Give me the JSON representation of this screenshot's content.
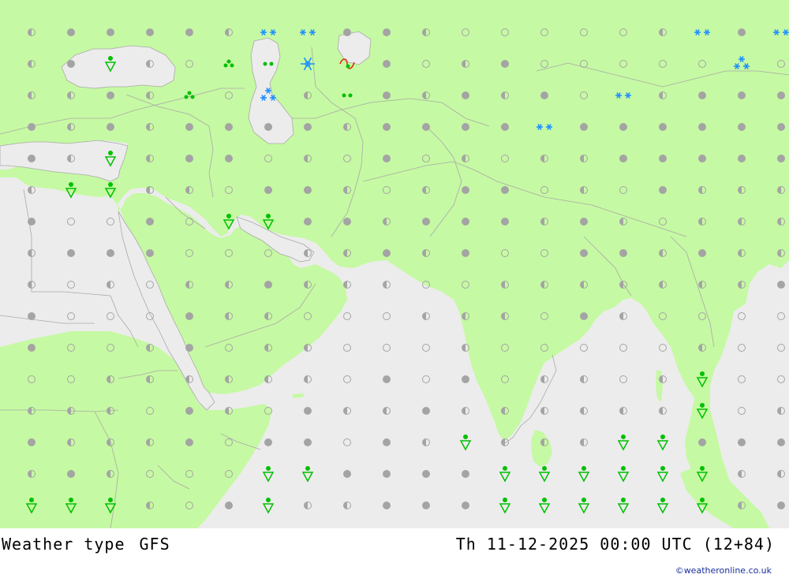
{
  "title": "Weather type",
  "model": "GFS",
  "valid_time": "Th 11-12-2025 00:00 UTC (12+84)",
  "credit": "©weatheronline.co.uk",
  "colors": {
    "land": "#c6f9a3",
    "sea": "#ececec",
    "border": "#a9a9a9",
    "dot": "#a4a4a4",
    "rain": "#00c000",
    "snow": "#1e90ff",
    "freezing": "#e03010"
  },
  "icon_legend": {
    "filled-dot": "overcast",
    "half-dot": "partly cloudy",
    "open-dot": "clear",
    "snow-pair": "snow",
    "snowflake": "heavy snow",
    "rain-dots": "rain",
    "rain-shower": "rain shower",
    "freezing-rain": "freezing rain"
  },
  "grid": {
    "rows": [
      "hFFFhoFhFFsFhFFhooooosFsFF",
      "hrhhhhhhhhhhhhhhhhhhhhhhhhhhhhhhhhhhhhhhhhhh",
      "hhhhhhhhhhhhhhhhhhhhhhhhhhhhhhhhhhhhhhhhhhhh",
      "FFhhhhhhhhhhhhhhhhhhhhhhhhhhhhhhhhhhhhhhhhhh"
    ],
    "cells": [
      "hFFFFhsshoFhFooooohsFsFF",
      "FhRhoRPoFoFhFhFoooSoSoSF",
      "FhFhoFPhPFSFhFoooosoFFhFo",
      "FhFhFFFFhFFFFFSFFFFhFFFFh",
      "FFhRhFFhhFhhhhhoFhooohhoo",
      "hRRhhoFFhohFFhhhhhhhohhoo",
      "FhooFoFRRFFhFFFFFhhhFhFFh",
      "hFFFooohhFhFooFFhFhhhFhhh",
      "hohohhFhhhhoohhhhhhhhohhh",
      "FoooohhooohhhoFhhohooohhF",
      "hoohhohhooohoooooooooohoF",
      "oohhhhhhhhoFohhohohoooFhh",
      "hhhoFhoFhhFhhhhhhhhhhhRhh",
      "hhhhhhhhhhhhhhhhhhhhhhhhh"
    ],
    "layout": {
      "weather": [
        [
          "half",
          "filled",
          "filled",
          "filled",
          "filled",
          "half",
          "snow2",
          "snow2",
          "filled",
          "filled",
          "half",
          "open",
          "open",
          "open",
          "open",
          "open",
          "half",
          "snow2",
          "filled",
          "snow2",
          "filled",
          "filled"
        ],
        [
          "half",
          "filled",
          "shower",
          "half",
          "open",
          "rain3",
          "rain2",
          "snowflake",
          "freezing",
          "filled",
          "open",
          "half",
          "filled",
          "open",
          "open",
          "open",
          "open",
          "open",
          "snow3",
          "open",
          "snow3",
          "filled"
        ],
        [
          "half",
          "half",
          "filled",
          "half",
          "rain3",
          "open",
          "snow3",
          "half",
          "rain2",
          "filled",
          "half",
          "filled",
          "half",
          "filled",
          "open",
          "snow2",
          "half",
          "filled",
          "filled",
          "filled",
          "filled",
          "filled"
        ],
        [
          "filled",
          "half",
          "filled",
          "half",
          "filled",
          "filled",
          "filled",
          "filled",
          "half",
          "filled",
          "filled",
          "filled",
          "filled",
          "snow2",
          "filled",
          "filled",
          "filled",
          "filled",
          "filled",
          "filled",
          "filled",
          "filled"
        ],
        [
          "filled",
          "half",
          "shower",
          "half",
          "filled",
          "filled",
          "open",
          "half",
          "open",
          "filled",
          "open",
          "half",
          "open",
          "half",
          "half",
          "filled",
          "filled",
          "filled",
          "filled",
          "filled",
          "half",
          "open"
        ],
        [
          "half",
          "shower",
          "shower",
          "half",
          "half",
          "open",
          "filled",
          "filled",
          "half",
          "open",
          "half",
          "filled",
          "filled",
          "open",
          "half",
          "open",
          "filled",
          "half",
          "half",
          "half",
          "half",
          "open"
        ],
        [
          "filled",
          "open",
          "open",
          "filled",
          "open",
          "shower",
          "shower",
          "filled",
          "filled",
          "half",
          "filled",
          "filled",
          "filled",
          "half",
          "filled",
          "half",
          "open",
          "half",
          "half",
          "half",
          "filled",
          "half"
        ],
        [
          "half",
          "filled",
          "filled",
          "filled",
          "open",
          "open",
          "open",
          "half",
          "half",
          "filled",
          "half",
          "filled",
          "open",
          "open",
          "filled",
          "filled",
          "half",
          "filled",
          "half",
          "half",
          "filled",
          "half"
        ],
        [
          "half",
          "open",
          "half",
          "open",
          "half",
          "half",
          "filled",
          "half",
          "half",
          "half",
          "open",
          "open",
          "half",
          "half",
          "half",
          "half",
          "half",
          "half",
          "half",
          "filled",
          "half",
          "half"
        ],
        [
          "filled",
          "open",
          "open",
          "open",
          "filled",
          "half",
          "half",
          "open",
          "open",
          "open",
          "half",
          "half",
          "half",
          "open",
          "filled",
          "half",
          "open",
          "open",
          "open",
          "open",
          "open",
          "half"
        ],
        [
          "filled",
          "open",
          "open",
          "half",
          "filled",
          "open",
          "half",
          "half",
          "open",
          "open",
          "open",
          "half",
          "open",
          "open",
          "open",
          "open",
          "open",
          "half",
          "open",
          "open",
          "half",
          "filled"
        ],
        [
          "open",
          "open",
          "half",
          "half",
          "half",
          "half",
          "half",
          "half",
          "open",
          "filled",
          "open",
          "filled",
          "open",
          "half",
          "half",
          "open",
          "half",
          "shower",
          "open",
          "open",
          "filled",
          "half"
        ],
        [
          "half",
          "half",
          "half",
          "open",
          "filled",
          "half",
          "open",
          "filled",
          "half",
          "half",
          "filled",
          "half",
          "half",
          "half",
          "half",
          "half",
          "half",
          "shower",
          "open",
          "half",
          "filled",
          "shower"
        ],
        [
          "filled",
          "half",
          "half",
          "half",
          "filled",
          "open",
          "filled",
          "filled",
          "open",
          "filled",
          "half",
          "shower",
          "half",
          "half",
          "half",
          "shower",
          "shower",
          "filled",
          "filled",
          "filled",
          "half",
          "shower"
        ],
        [
          "half",
          "filled",
          "half",
          "open",
          "open",
          "open",
          "shower",
          "shower",
          "filled",
          "filled",
          "filled",
          "filled",
          "shower",
          "shower",
          "shower",
          "shower",
          "shower",
          "shower",
          "half",
          "half",
          "half",
          "filled"
        ],
        [
          "shower",
          "shower",
          "shower",
          "half",
          "open",
          "filled",
          "shower",
          "half",
          "half",
          "filled",
          "filled",
          "filled",
          "shower",
          "shower",
          "shower",
          "shower",
          "shower",
          "shower",
          "half",
          "filled",
          "open",
          "half"
        ]
      ]
    }
  }
}
